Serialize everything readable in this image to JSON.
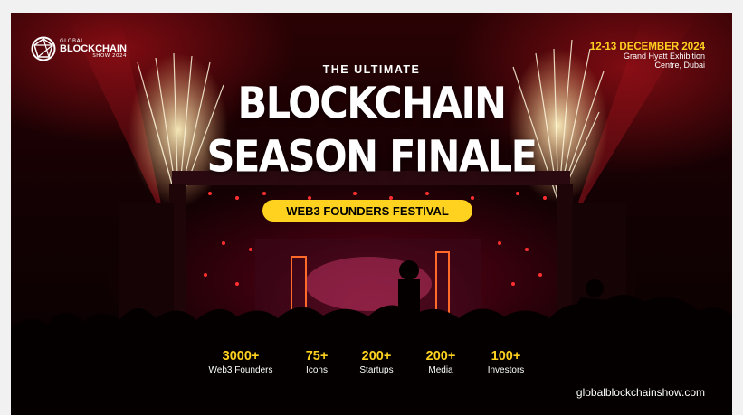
{
  "logo": {
    "line1": "GLOBAL",
    "line2": "BLOCKCHAIN",
    "line3": "SHOW 2024"
  },
  "event": {
    "date": "12-13 DECEMBER 2024",
    "venue_line1": "Grand Hyatt Exhibition",
    "venue_line2": "Centre, Dubai"
  },
  "headline": {
    "kicker": "THE ULTIMATE",
    "line1": "BLOCKCHAIN",
    "line2": "SEASON FINALE"
  },
  "pill": {
    "label": "WEB3 FOUNDERS FESTIVAL"
  },
  "stats": [
    {
      "value": "3000+",
      "label": "Web3 Founders"
    },
    {
      "value": "75+",
      "label": "Icons"
    },
    {
      "value": "200+",
      "label": "Startups"
    },
    {
      "value": "200+",
      "label": "Media"
    },
    {
      "value": "100+",
      "label": "Investors"
    }
  ],
  "website": "globalblockchainshow.com",
  "colors": {
    "accent_yellow": "#ffd21f",
    "background_dark": "#140103",
    "stage_red": "#ff2a2a",
    "page_bg": "#f1f1f1"
  },
  "icons": {
    "logo_mark": "globe-network-icon"
  }
}
